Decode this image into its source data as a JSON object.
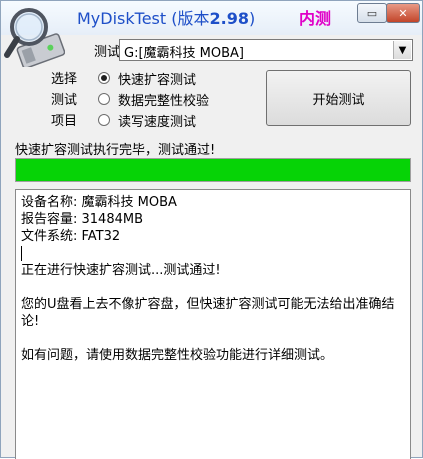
{
  "window": {
    "app_name": "MyDiskTest",
    "version_prefix": "(版本",
    "version": "2.98",
    "version_suffix": ")",
    "badge": "内测",
    "minimize_glyph": "▭",
    "close_glyph": "✕"
  },
  "icons": {
    "logo": "magnifier-disk-icon",
    "dropdown": "chevron-down-icon"
  },
  "drive": {
    "label": "测试:",
    "value": "G:[魔霸科技 MOBA]",
    "arrow": "▼"
  },
  "mode": {
    "group_label": [
      "选择",
      "测试",
      "项目"
    ],
    "options": [
      {
        "label": "快速扩容测试",
        "selected": true
      },
      {
        "label": "数据完整性校验",
        "selected": false
      },
      {
        "label": "读写速度测试",
        "selected": false
      }
    ]
  },
  "start_button": "开始测试",
  "status": {
    "text": "快速扩容测试执行完毕，测试通过!",
    "progress": 1.0,
    "color": "#06d306"
  },
  "log": {
    "lines": [
      "设备名称: 魔霸科技 MOBA",
      "报告容量: 31484MB",
      "文件系统: FAT32",
      "",
      "正在进行快速扩容测试...测试通过!",
      "",
      "您的U盘看上去不像扩容盘，但快速扩容测试可能无法给出准确结论!",
      "",
      "如有问题，请使用数据完整性校验功能进行详细测试。"
    ]
  },
  "colors": {
    "title": "#1e4fc8",
    "badge": "#e000c8",
    "progress_fill": "#06d306"
  }
}
